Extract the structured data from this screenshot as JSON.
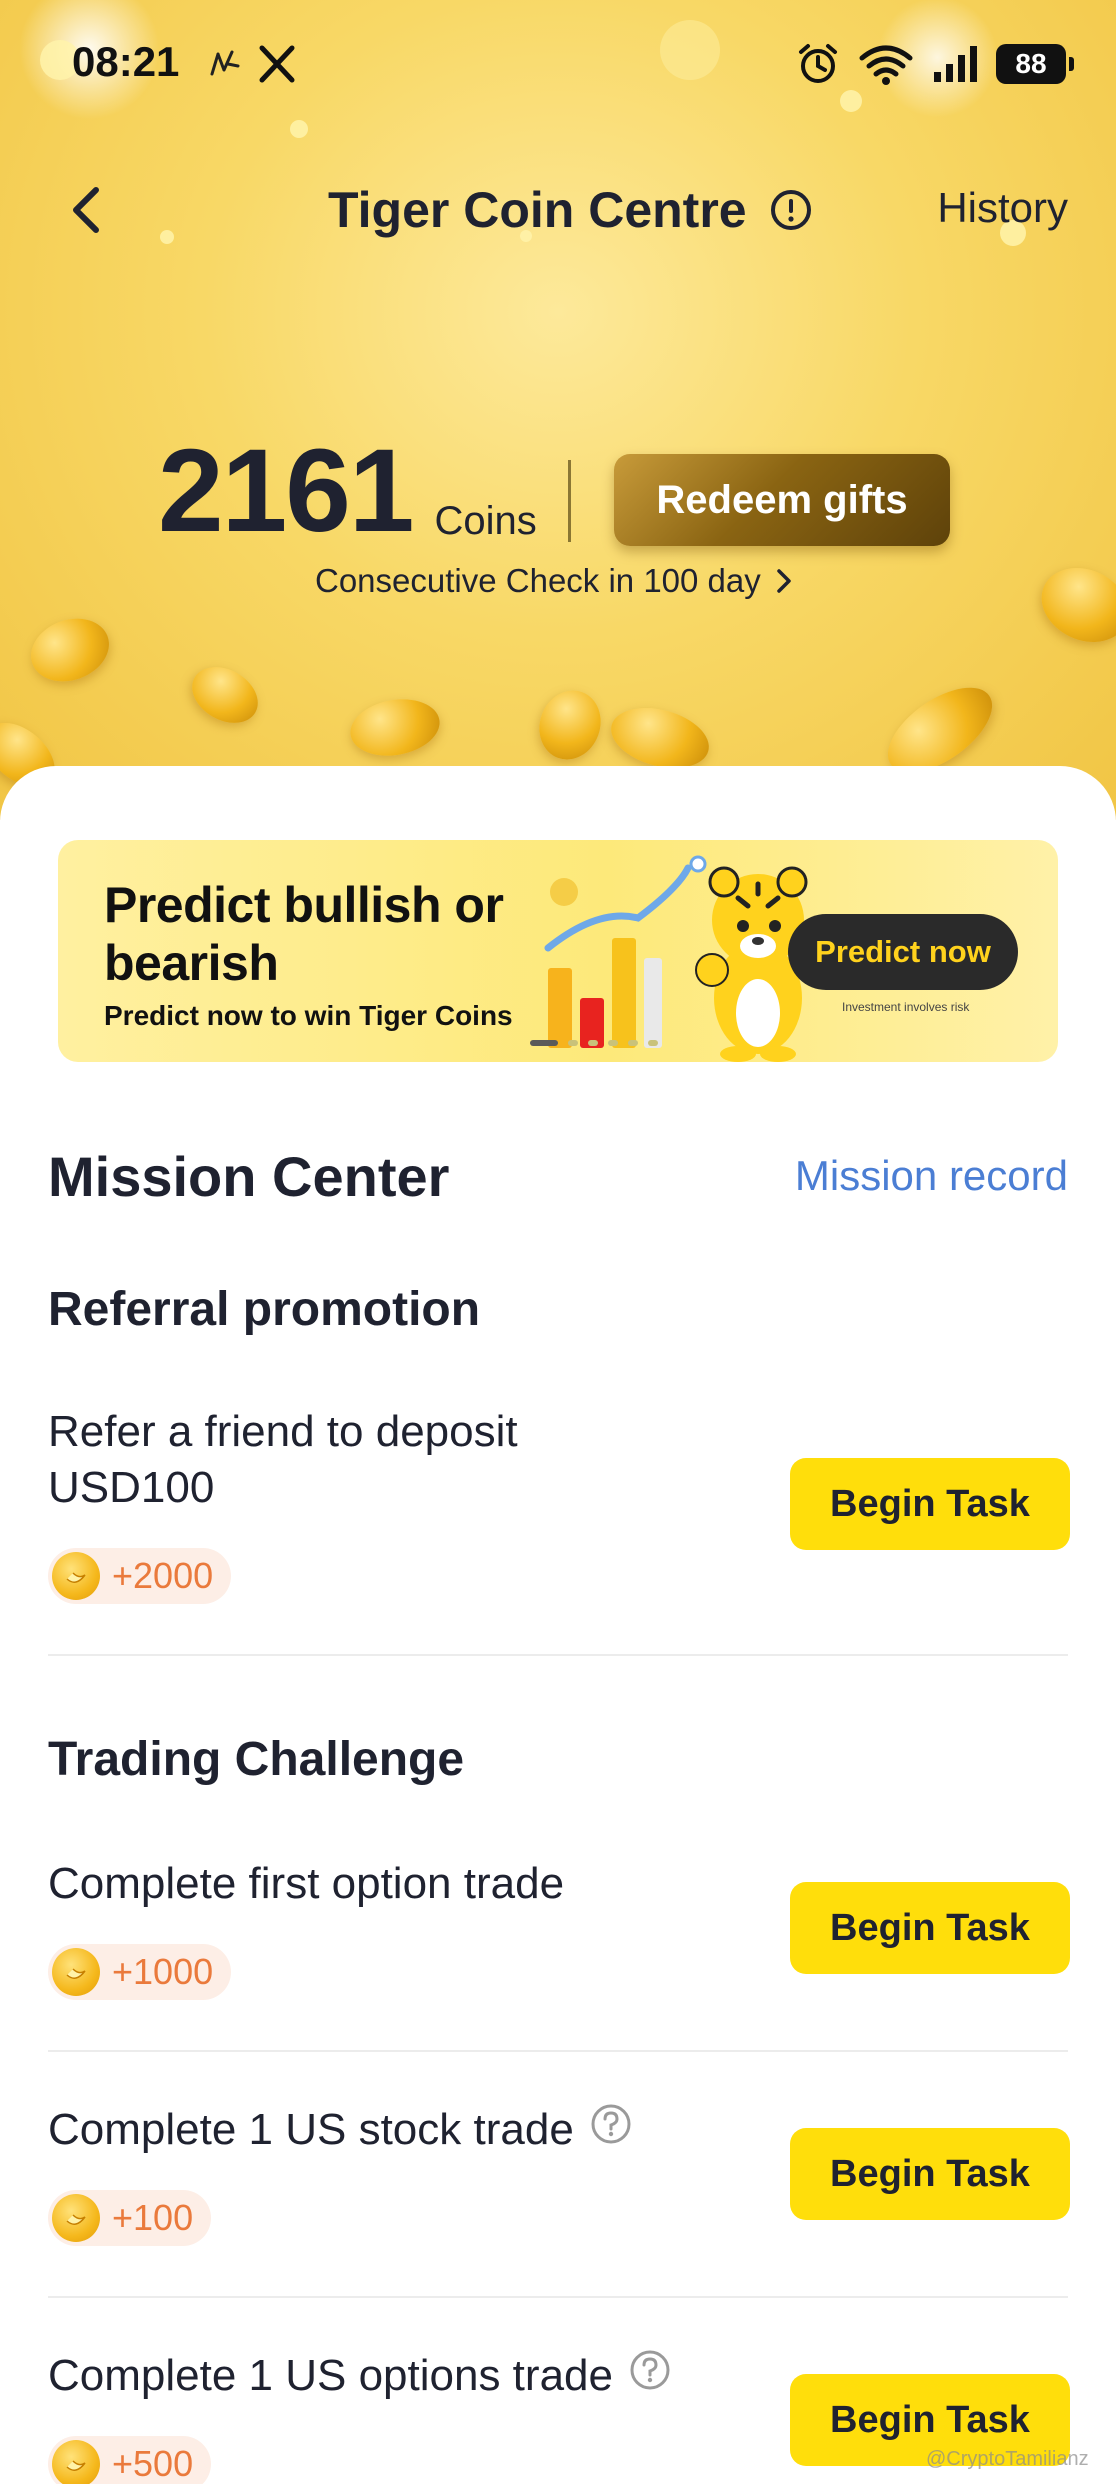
{
  "status_bar": {
    "time": "08:21",
    "battery": "88"
  },
  "nav": {
    "title": "Tiger Coin Centre",
    "history": "History"
  },
  "balance": {
    "count": "2161",
    "unit": "Coins",
    "redeem": "Redeem gifts",
    "checkin": "Consecutive Check in 100 day"
  },
  "banner": {
    "title": "Predict bullish or bearish",
    "subtitle": "Predict now to win Tiger Coins",
    "button": "Predict now",
    "risk": "Investment involves risk"
  },
  "mission": {
    "title": "Mission Center",
    "record_link": "Mission record",
    "groups": [
      {
        "title": "Referral promotion",
        "tasks": [
          {
            "name": "Refer a friend to deposit USD100",
            "reward": "+2000",
            "button": "Begin Task"
          }
        ]
      },
      {
        "title": "Trading Challenge",
        "tasks": [
          {
            "name": "Complete first option trade",
            "reward": "+1000",
            "button": "Begin Task"
          },
          {
            "name": "Complete 1 US stock trade",
            "reward": "+100",
            "button": "Begin Task"
          },
          {
            "name": "Complete 1 US options trade",
            "reward": "+500",
            "button": "Begin Task"
          }
        ]
      }
    ]
  },
  "watermark": "@CryptoTamilianz",
  "colors": {
    "accent_yellow": "#ffde0b",
    "link_blue": "#4b7ed4",
    "reward_orange": "#ea7a3c"
  }
}
